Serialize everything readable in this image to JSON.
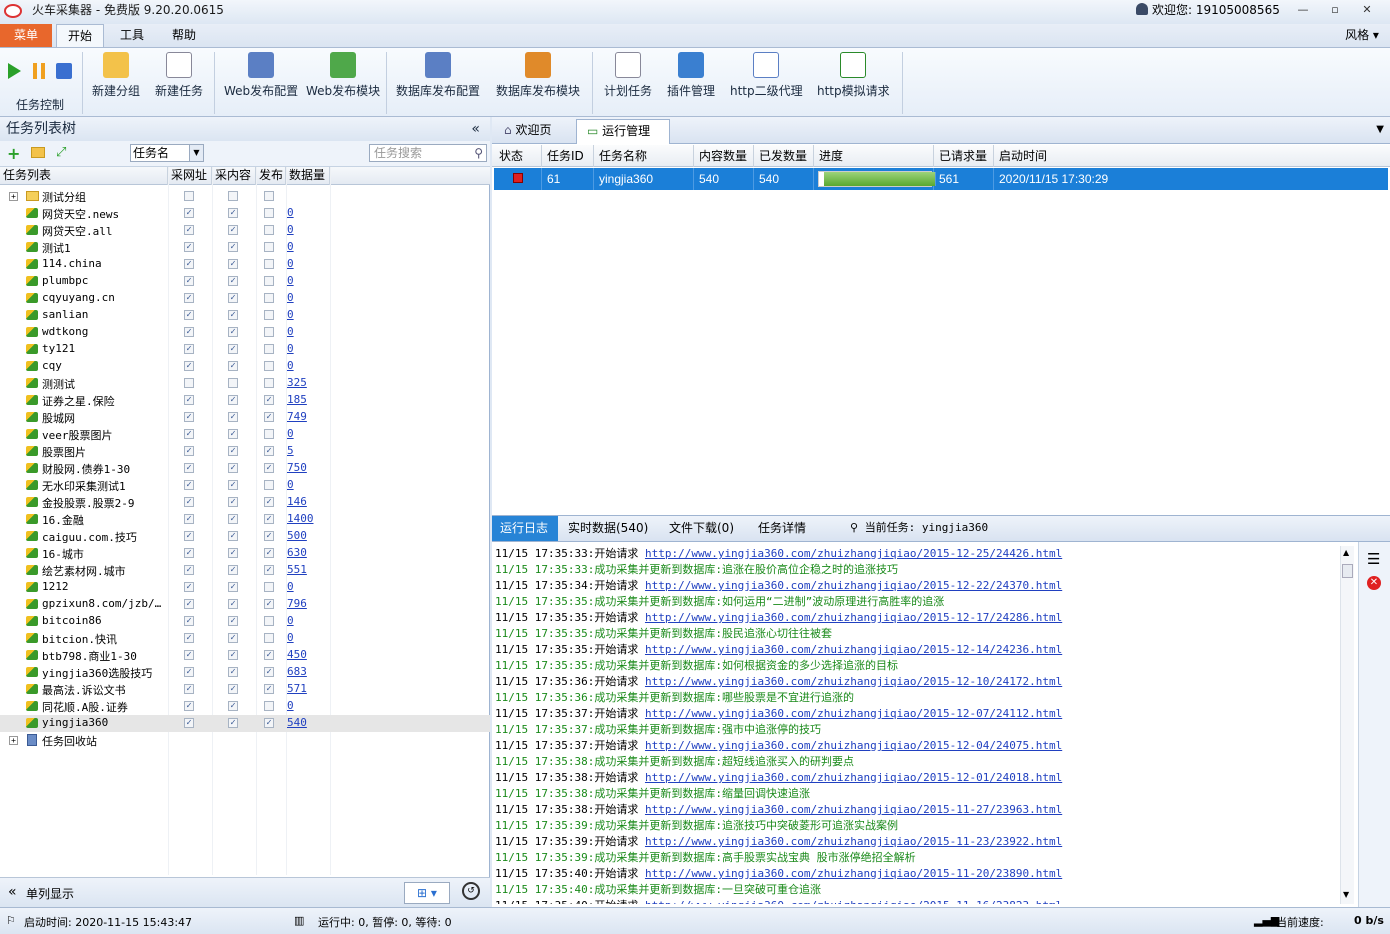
{
  "app": {
    "title": "火车采集器 - 免费版 9.20.20.0615",
    "user": "欢迎您: 19105008565",
    "style_label": "风格"
  },
  "menu": {
    "main": "菜单",
    "tabs": [
      "开始",
      "工具",
      "帮助"
    ]
  },
  "ribbon": {
    "task_control": "任务控制",
    "buttons": [
      "新建分组",
      "新建任务",
      "Web发布配置",
      "Web发布模块",
      "数据库发布配置",
      "数据库发布模块",
      "计划任务",
      "插件管理",
      "http二级代理",
      "http模拟请求"
    ]
  },
  "left": {
    "title": "任务列表树",
    "combo_value": "任务名",
    "search_placeholder": "任务搜索",
    "columns": [
      "任务列表",
      "采网址",
      "采内容",
      "发布",
      "数据量"
    ],
    "group_name": "测试分组",
    "recycle": "任务回收站",
    "footer_label": "单列显示",
    "tasks": [
      {
        "name": "网贷天空.news",
        "url": true,
        "content": true,
        "publish": false,
        "count": "0"
      },
      {
        "name": "网贷天空.all",
        "url": true,
        "content": true,
        "publish": false,
        "count": "0"
      },
      {
        "name": "测试1",
        "url": true,
        "content": true,
        "publish": false,
        "count": "0"
      },
      {
        "name": "114.china",
        "url": true,
        "content": true,
        "publish": false,
        "count": "0"
      },
      {
        "name": "plumbpc",
        "url": true,
        "content": true,
        "publish": false,
        "count": "0"
      },
      {
        "name": "cqyuyang.cn",
        "url": true,
        "content": true,
        "publish": false,
        "count": "0"
      },
      {
        "name": "sanlian",
        "url": true,
        "content": true,
        "publish": false,
        "count": "0"
      },
      {
        "name": "wdtkong",
        "url": true,
        "content": true,
        "publish": false,
        "count": "0"
      },
      {
        "name": "ty121",
        "url": true,
        "content": true,
        "publish": false,
        "count": "0"
      },
      {
        "name": "cqy",
        "url": true,
        "content": true,
        "publish": false,
        "count": "0"
      },
      {
        "name": "测测试",
        "url": false,
        "content": false,
        "publish": false,
        "count": "325"
      },
      {
        "name": "证券之星.保险",
        "url": true,
        "content": true,
        "publish": true,
        "count": "185"
      },
      {
        "name": "股城网",
        "url": true,
        "content": true,
        "publish": true,
        "count": "749"
      },
      {
        "name": "veer股票图片",
        "url": true,
        "content": true,
        "publish": false,
        "count": "0"
      },
      {
        "name": "股票图片",
        "url": true,
        "content": true,
        "publish": true,
        "count": "5"
      },
      {
        "name": "财股网.债券1-30",
        "url": true,
        "content": true,
        "publish": true,
        "count": "750"
      },
      {
        "name": "无水印采集测试1",
        "url": true,
        "content": true,
        "publish": false,
        "count": "0"
      },
      {
        "name": "金投股票.股票2-9",
        "url": true,
        "content": true,
        "publish": true,
        "count": "146"
      },
      {
        "name": "16.金融",
        "url": true,
        "content": true,
        "publish": true,
        "count": "1400"
      },
      {
        "name": "caiguu.com.技巧",
        "url": true,
        "content": true,
        "publish": true,
        "count": "500"
      },
      {
        "name": "16-城市",
        "url": true,
        "content": true,
        "publish": true,
        "count": "630"
      },
      {
        "name": "绘艺素材网.城市",
        "url": true,
        "content": true,
        "publish": true,
        "count": "551"
      },
      {
        "name": "1212",
        "url": true,
        "content": true,
        "publish": false,
        "count": "0"
      },
      {
        "name": "gpzixun8.com/jzb/…",
        "url": true,
        "content": true,
        "publish": true,
        "count": "796"
      },
      {
        "name": "bitcoin86",
        "url": true,
        "content": true,
        "publish": false,
        "count": "0"
      },
      {
        "name": "bitcion.快讯",
        "url": true,
        "content": true,
        "publish": false,
        "count": "0"
      },
      {
        "name": "btb798.商业1-30",
        "url": true,
        "content": true,
        "publish": true,
        "count": "450"
      },
      {
        "name": "yingjia360选股技巧",
        "url": true,
        "content": true,
        "publish": true,
        "count": "683"
      },
      {
        "name": "最高法.诉讼文书",
        "url": true,
        "content": true,
        "publish": true,
        "count": "571"
      },
      {
        "name": "同花顺.A股.证券",
        "url": true,
        "content": true,
        "publish": false,
        "count": "0"
      },
      {
        "name": "yingjia360",
        "url": true,
        "content": true,
        "publish": true,
        "count": "540"
      }
    ]
  },
  "right": {
    "tabs": [
      "欢迎页",
      "运行管理"
    ],
    "grid_columns": [
      "状态",
      "任务ID",
      "任务名称",
      "内容数量",
      "已发数量",
      "进度",
      "已请求量",
      "启动时间"
    ],
    "run": {
      "id": "61",
      "name": "yingjia360",
      "content": "540",
      "published": "540",
      "progress": 1.0,
      "requested": "561",
      "start": "2020/11/15 17:30:29"
    },
    "log_tabs": [
      "运行日志",
      "实时数据(540)",
      "文件下载(0)",
      "任务详情"
    ],
    "current_task": "当前任务: yingjia360",
    "log": [
      {
        "t": "11/15 17:35:33:",
        "msg": "开始请求 ",
        "url": "http://www.yingjia360.com/zhuizhangjiqiao/2015-12-25/24426.html",
        "ok": false
      },
      {
        "t": "11/15 17:35:33:",
        "msg": "成功采集并更新到数据库:追涨在股价高位企稳之时的追涨技巧",
        "url": "",
        "ok": true
      },
      {
        "t": "11/15 17:35:34:",
        "msg": "开始请求 ",
        "url": "http://www.yingjia360.com/zhuizhangjiqiao/2015-12-22/24370.html",
        "ok": false
      },
      {
        "t": "11/15 17:35:35:",
        "msg": "成功采集并更新到数据库:如何运用“二进制”波动原理进行高胜率的追涨",
        "url": "",
        "ok": true
      },
      {
        "t": "11/15 17:35:35:",
        "msg": "开始请求 ",
        "url": "http://www.yingjia360.com/zhuizhangjiqiao/2015-12-17/24286.html",
        "ok": false
      },
      {
        "t": "11/15 17:35:35:",
        "msg": "成功采集并更新到数据库:股民追涨心切往往被套",
        "url": "",
        "ok": true
      },
      {
        "t": "11/15 17:35:35:",
        "msg": "开始请求 ",
        "url": "http://www.yingjia360.com/zhuizhangjiqiao/2015-12-14/24236.html",
        "ok": false
      },
      {
        "t": "11/15 17:35:35:",
        "msg": "成功采集并更新到数据库:如何根据资金的多少选择追涨的目标",
        "url": "",
        "ok": true
      },
      {
        "t": "11/15 17:35:36:",
        "msg": "开始请求 ",
        "url": "http://www.yingjia360.com/zhuizhangjiqiao/2015-12-10/24172.html",
        "ok": false
      },
      {
        "t": "11/15 17:35:36:",
        "msg": "成功采集并更新到数据库:哪些股票是不宜进行追涨的",
        "url": "",
        "ok": true
      },
      {
        "t": "11/15 17:35:37:",
        "msg": "开始请求 ",
        "url": "http://www.yingjia360.com/zhuizhangjiqiao/2015-12-07/24112.html",
        "ok": false
      },
      {
        "t": "11/15 17:35:37:",
        "msg": "成功采集并更新到数据库:强市中追涨停的技巧",
        "url": "",
        "ok": true
      },
      {
        "t": "11/15 17:35:37:",
        "msg": "开始请求 ",
        "url": "http://www.yingjia360.com/zhuizhangjiqiao/2015-12-04/24075.html",
        "ok": false
      },
      {
        "t": "11/15 17:35:38:",
        "msg": "成功采集并更新到数据库:超短线追涨买入的研判要点",
        "url": "",
        "ok": true
      },
      {
        "t": "11/15 17:35:38:",
        "msg": "开始请求 ",
        "url": "http://www.yingjia360.com/zhuizhangjiqiao/2015-12-01/24018.html",
        "ok": false
      },
      {
        "t": "11/15 17:35:38:",
        "msg": "成功采集并更新到数据库:缩量回调快速追涨",
        "url": "",
        "ok": true
      },
      {
        "t": "11/15 17:35:38:",
        "msg": "开始请求 ",
        "url": "http://www.yingjia360.com/zhuizhangjiqiao/2015-11-27/23963.html",
        "ok": false
      },
      {
        "t": "11/15 17:35:39:",
        "msg": "成功采集并更新到数据库:追涨技巧中突破菱形可追涨实战案例",
        "url": "",
        "ok": true
      },
      {
        "t": "11/15 17:35:39:",
        "msg": "开始请求 ",
        "url": "http://www.yingjia360.com/zhuizhangjiqiao/2015-11-23/23922.html",
        "ok": false
      },
      {
        "t": "11/15 17:35:39:",
        "msg": "成功采集并更新到数据库:高手股票实战宝典 股市涨停绝招全解析",
        "url": "",
        "ok": true
      },
      {
        "t": "11/15 17:35:40:",
        "msg": "开始请求 ",
        "url": "http://www.yingjia360.com/zhuizhangjiqiao/2015-11-20/23890.html",
        "ok": false
      },
      {
        "t": "11/15 17:35:40:",
        "msg": "成功采集并更新到数据库:一旦突破可重仓追涨",
        "url": "",
        "ok": true
      },
      {
        "t": "11/15 17:35:40:",
        "msg": "开始请求 ",
        "url": "http://www.yingjia360.com/zhuizhangjiqiao/2015-11-16/23823.html",
        "ok": false
      }
    ]
  },
  "status": {
    "start_time": "启动时间:  2020-11-15 15:43:47",
    "running": "运行中: 0,  暂停: 0,  等待: 0",
    "speed_label": "当前速度:",
    "speed_value": "0 b/s"
  }
}
